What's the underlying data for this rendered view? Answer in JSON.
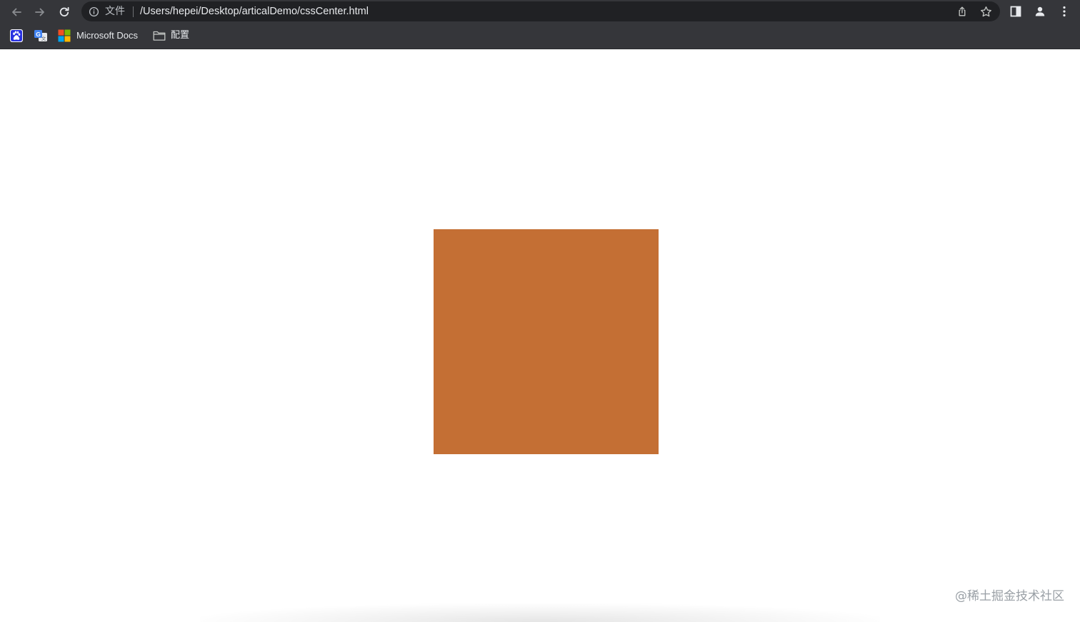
{
  "window": {
    "toolbar_bg": "#35363a",
    "omnibox_bg": "#202124"
  },
  "navigation": {
    "back_icon": "arrow-left-icon",
    "forward_icon": "arrow-right-icon",
    "reload_icon": "reload-icon"
  },
  "omnibox": {
    "site_info_icon": "info-circle-icon",
    "site_info_label": "文件",
    "url": "/Users/hepei/Desktop/articalDemo/cssCenter.html",
    "share_icon": "share-icon",
    "bookmark_icon": "star-icon"
  },
  "toolbar_icons": {
    "side_panel": "side-panel-icon",
    "profile": "profile-icon",
    "menu": "kebab-menu-icon"
  },
  "bookmarks": [
    {
      "icon": "baidu-paw-icon",
      "label": ""
    },
    {
      "icon": "google-translate-icon",
      "label": ""
    },
    {
      "icon": "microsoft-logo-icon",
      "label": "Microsoft Docs"
    },
    {
      "icon": "folder-icon",
      "label": "配置"
    }
  ],
  "page": {
    "background": "#ffffff",
    "box_color": "#c46f34",
    "watermark": "@稀土掘金技术社区"
  }
}
